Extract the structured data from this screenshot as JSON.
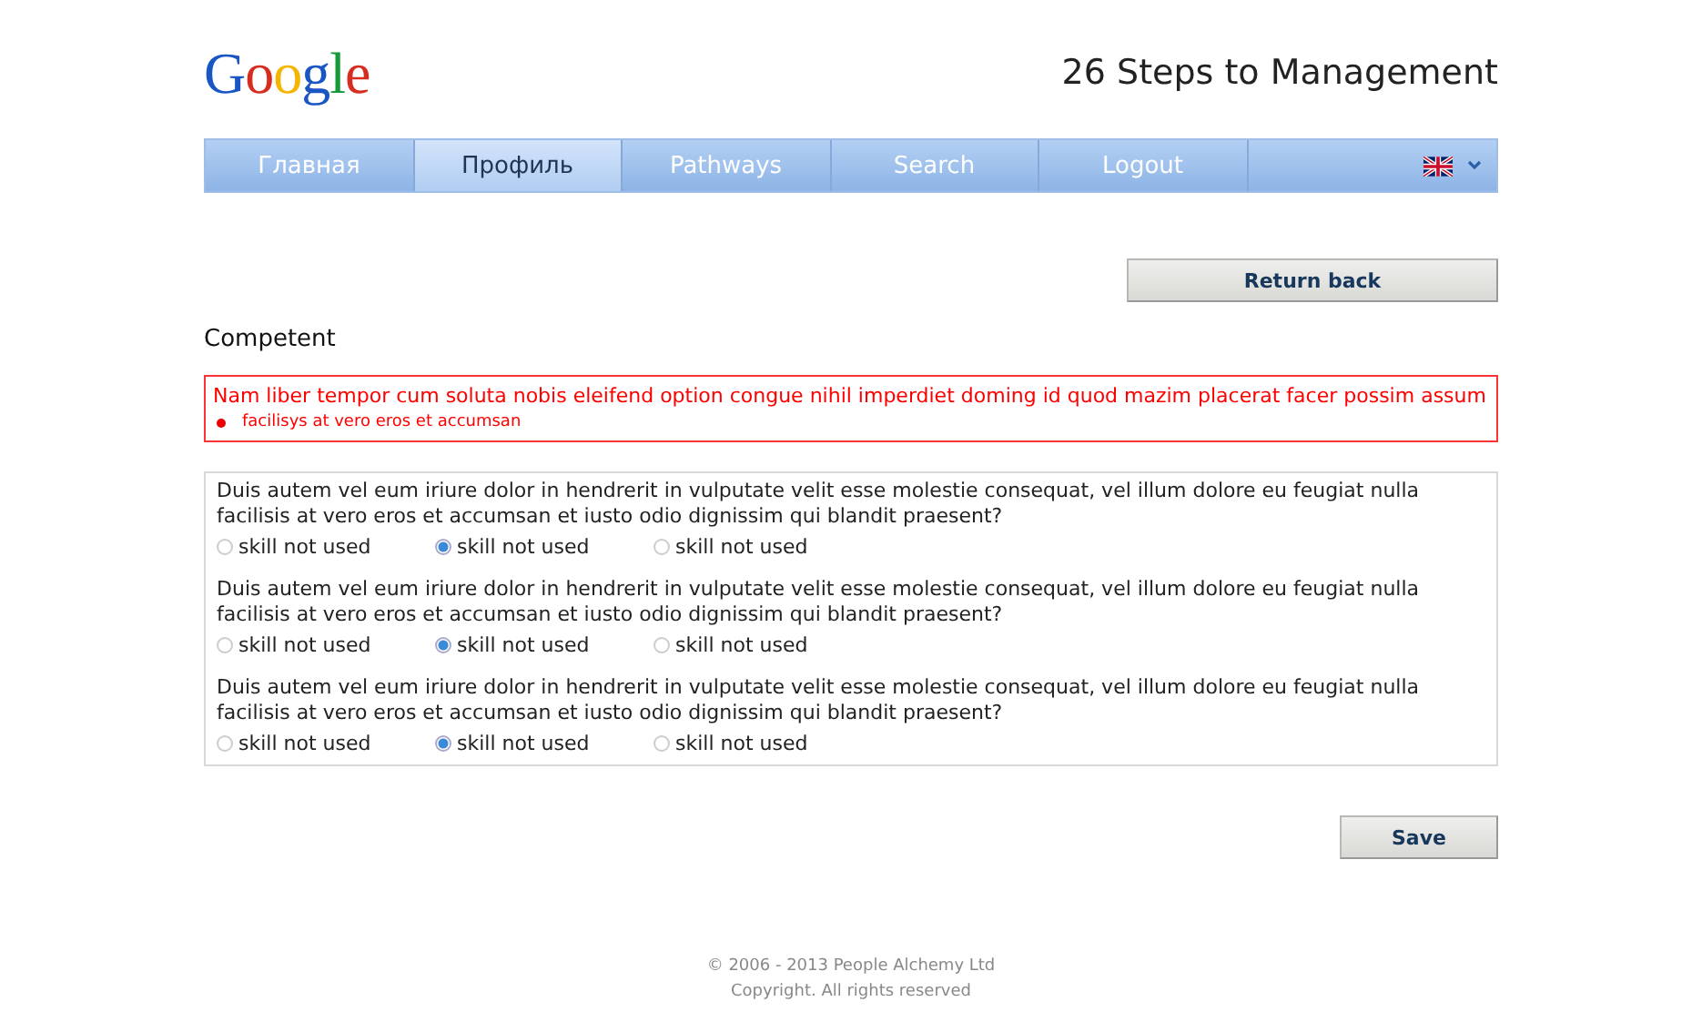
{
  "logo": "Google",
  "site_title": "26 Steps to Management",
  "tabs": [
    {
      "label": "Главная",
      "selected": false
    },
    {
      "label": "Профиль",
      "selected": true
    },
    {
      "label": "Pathways",
      "selected": false
    },
    {
      "label": "Search",
      "selected": false
    },
    {
      "label": "Logout",
      "selected": false
    }
  ],
  "return_button": "Return back",
  "section_title": "Competent",
  "error": {
    "message": "Nam liber tempor cum soluta nobis eleifend option congue nihil imperdiet doming id quod mazim placerat facer possim assum",
    "items": [
      "facilisys at vero eros et accumsan"
    ]
  },
  "questions": [
    {
      "text": "Duis autem vel eum iriure dolor in hendrerit in vulputate velit esse molestie consequat, vel illum dolore eu feugiat nulla facilisis at vero eros et accumsan et iusto odio dignissim qui blandit praesent?",
      "options": [
        {
          "label": "skill not used",
          "selected": false
        },
        {
          "label": "skill not used",
          "selected": true
        },
        {
          "label": "skill not used",
          "selected": false
        }
      ]
    },
    {
      "text": "Duis autem vel eum iriure dolor in hendrerit in vulputate velit esse molestie consequat, vel illum dolore eu feugiat nulla facilisis at vero eros et accumsan et iusto odio dignissim qui blandit praesent?",
      "options": [
        {
          "label": "skill not used",
          "selected": false
        },
        {
          "label": "skill not used",
          "selected": true
        },
        {
          "label": "skill not used",
          "selected": false
        }
      ]
    },
    {
      "text": "Duis autem vel eum iriure dolor in hendrerit in vulputate velit esse molestie consequat, vel illum dolore eu feugiat nulla facilisis at vero eros et accumsan et iusto odio dignissim qui blandit praesent?",
      "options": [
        {
          "label": "skill not used",
          "selected": false
        },
        {
          "label": "skill not used",
          "selected": true
        },
        {
          "label": "skill not used",
          "selected": false
        }
      ]
    }
  ],
  "save_button": "Save",
  "footer": [
    "© 2006 - 2013 People Alchemy Ltd",
    "Copyright. All rights reserved"
  ]
}
